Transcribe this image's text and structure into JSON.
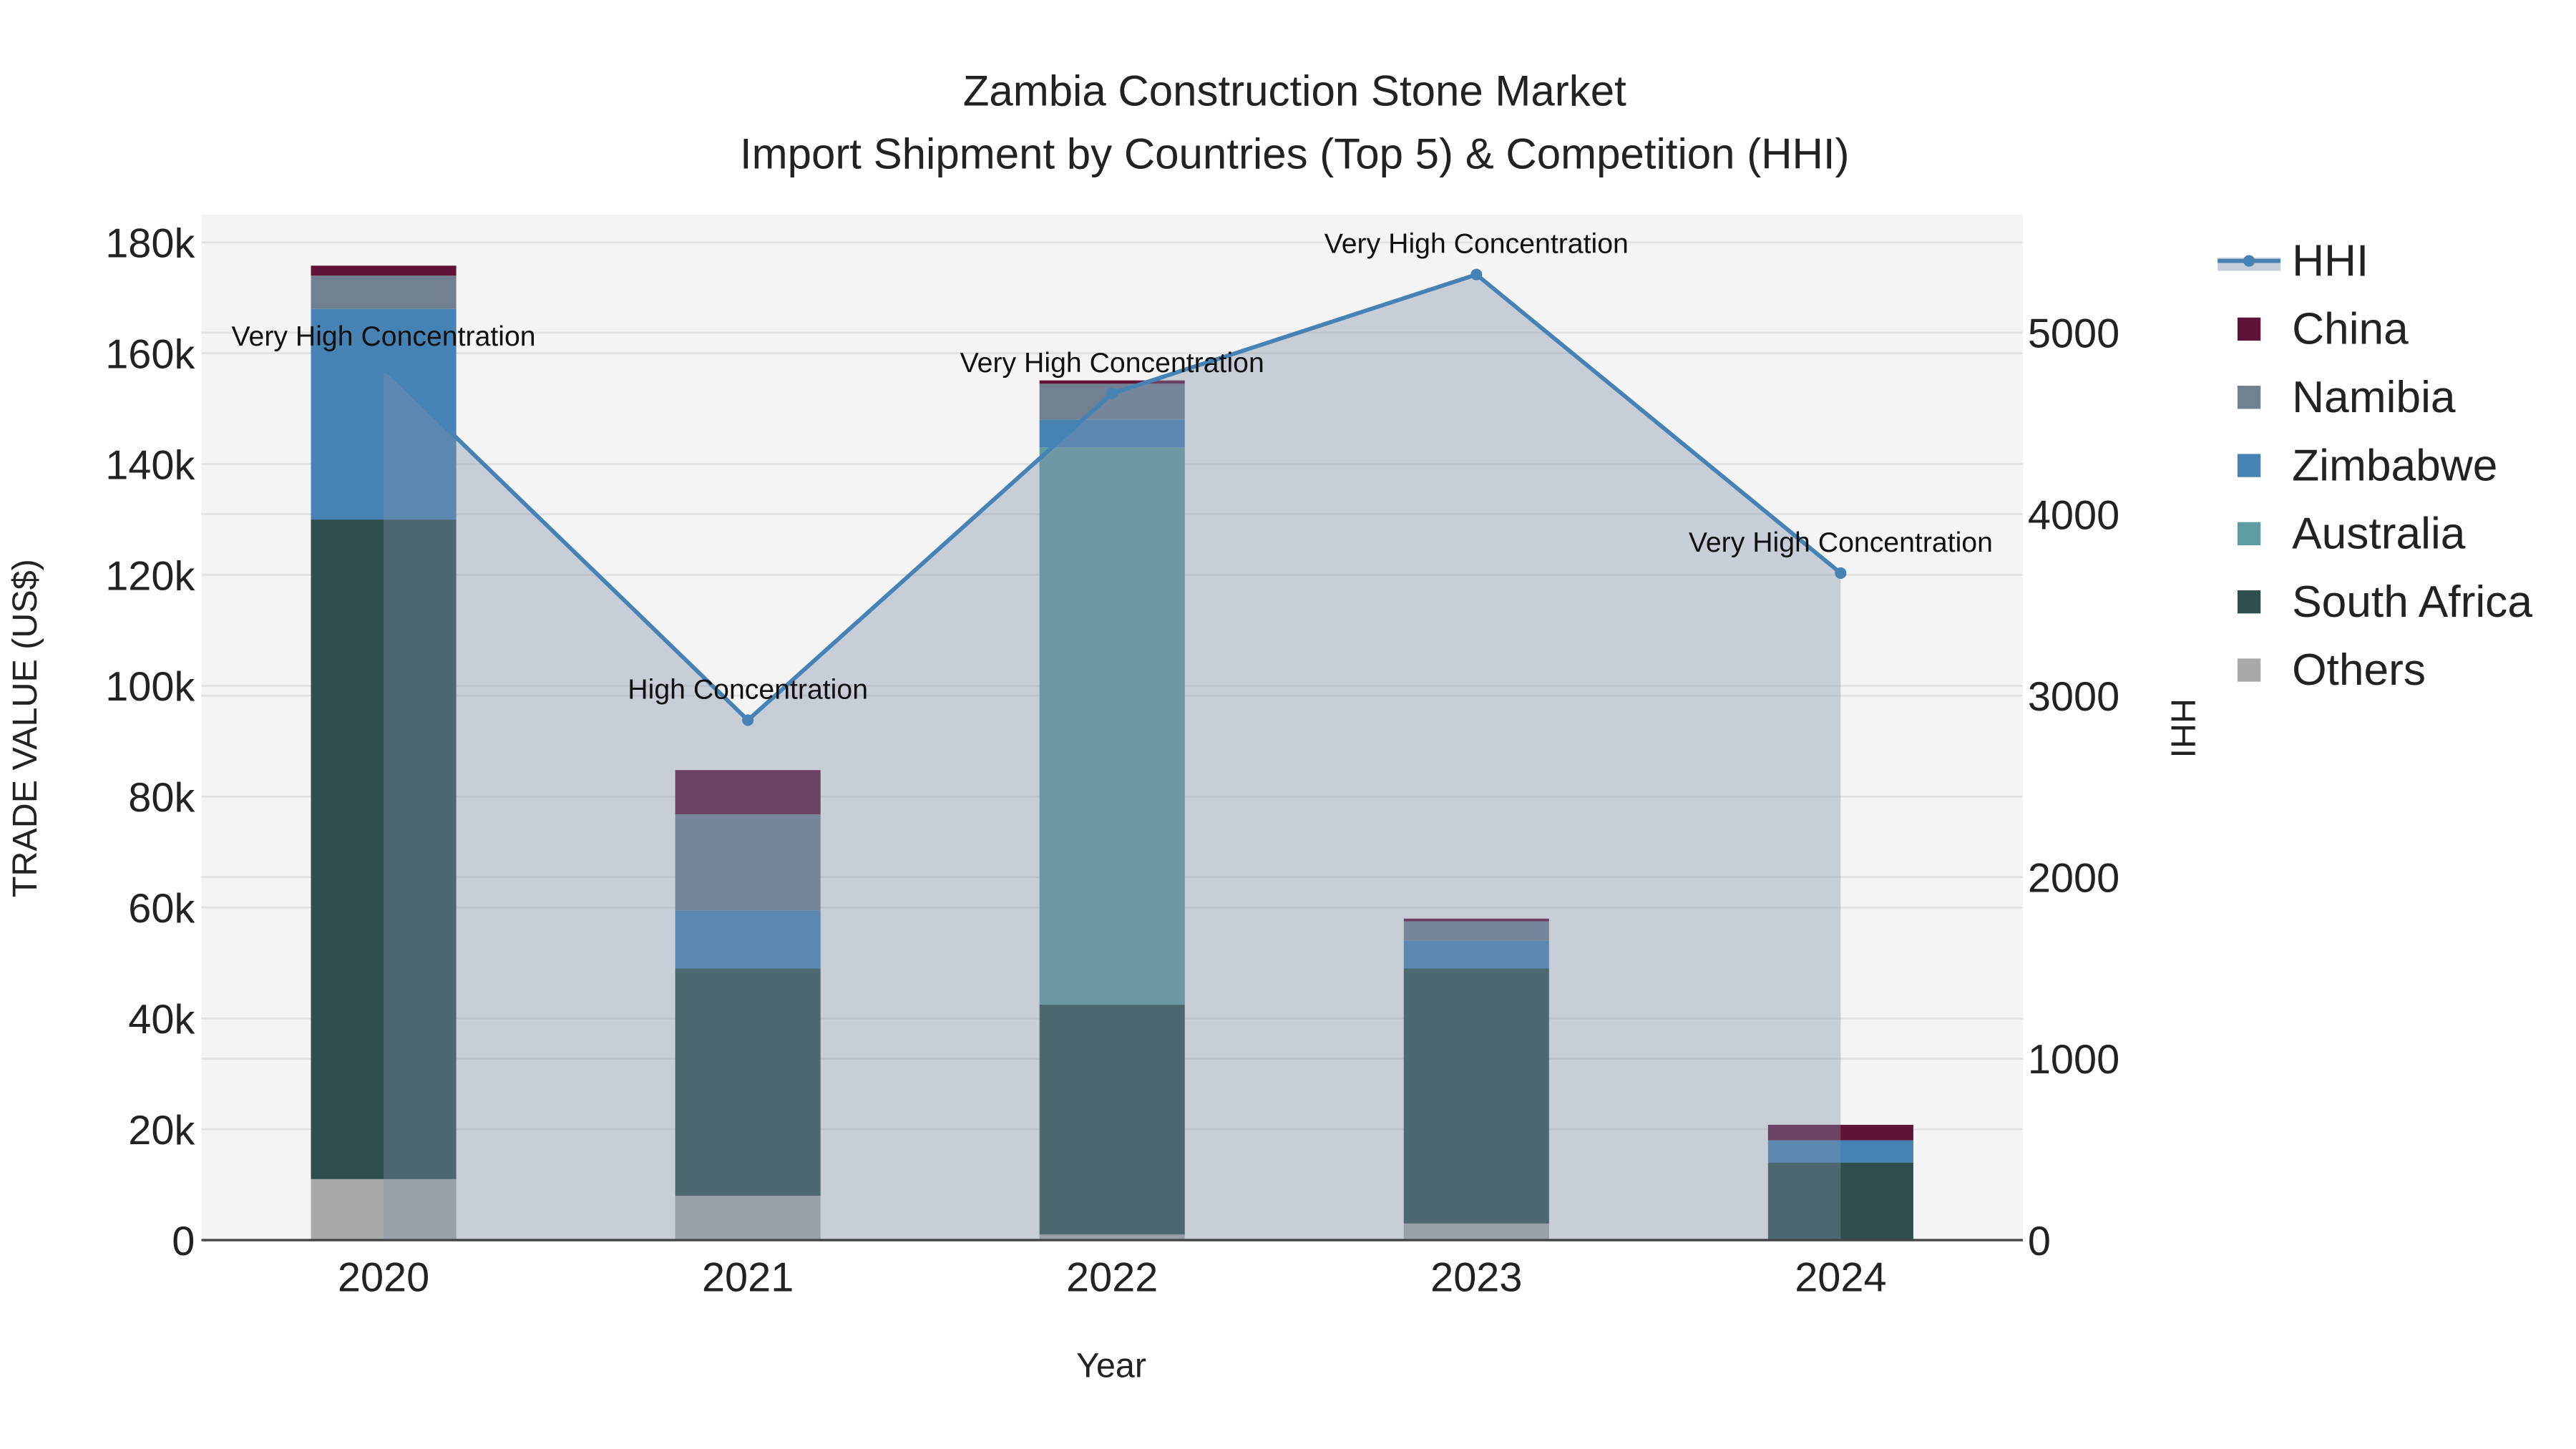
{
  "chart_data": {
    "type": "bar",
    "title_line1": "Zambia Construction Stone Market",
    "title_line2": "Import Shipment by Countries (Top 5) & Competition (HHI)",
    "xlabel": "Year",
    "ylabel": "TRADE VALUE (US$)",
    "y2label": "HHI",
    "categories": [
      "2020",
      "2021",
      "2022",
      "2023",
      "2024"
    ],
    "ylim": [
      0,
      185000
    ],
    "y2lim": [
      0,
      5650
    ],
    "yticks": [
      0,
      20000,
      40000,
      60000,
      80000,
      100000,
      120000,
      140000,
      160000,
      180000
    ],
    "ytick_labels": [
      "0",
      "20k",
      "40k",
      "60k",
      "80k",
      "100k",
      "120k",
      "140k",
      "160k",
      "180k"
    ],
    "y2ticks": [
      0,
      1000,
      2000,
      3000,
      4000,
      5000
    ],
    "y2tick_labels": [
      "0",
      "1000",
      "2000",
      "3000",
      "4000",
      "5000"
    ],
    "grid": true,
    "legend_placement": "right",
    "series": [
      {
        "name": "Others",
        "color": "#a9a9a9",
        "values": [
          11000,
          8000,
          1000,
          3000,
          0
        ]
      },
      {
        "name": "South Africa",
        "color": "#2f4f4f",
        "values": [
          119000,
          41000,
          41500,
          46000,
          14000
        ]
      },
      {
        "name": "Australia",
        "color": "#5f9ea0",
        "values": [
          0,
          0,
          100500,
          0,
          0
        ]
      },
      {
        "name": "Zimbabwe",
        "color": "#4682b4",
        "values": [
          38000,
          10500,
          5000,
          5000,
          4000
        ]
      },
      {
        "name": "Namibia",
        "color": "#708090",
        "values": [
          6000,
          17300,
          6500,
          3500,
          0
        ]
      },
      {
        "name": "China",
        "color": "#5e1337",
        "values": [
          1800,
          8000,
          600,
          500,
          2800
        ]
      }
    ],
    "hhi": {
      "name": "HHI",
      "color": "#4682b4",
      "values": [
        4810,
        2865,
        4665,
        5320,
        3675
      ],
      "annotations": [
        "Very High Concentration",
        "High Concentration",
        "Very High Concentration",
        "Very High Concentration",
        "Very High Concentration"
      ]
    },
    "legend_order": [
      "HHI",
      "China",
      "Namibia",
      "Zimbabwe",
      "Australia",
      "South Africa",
      "Others"
    ]
  }
}
